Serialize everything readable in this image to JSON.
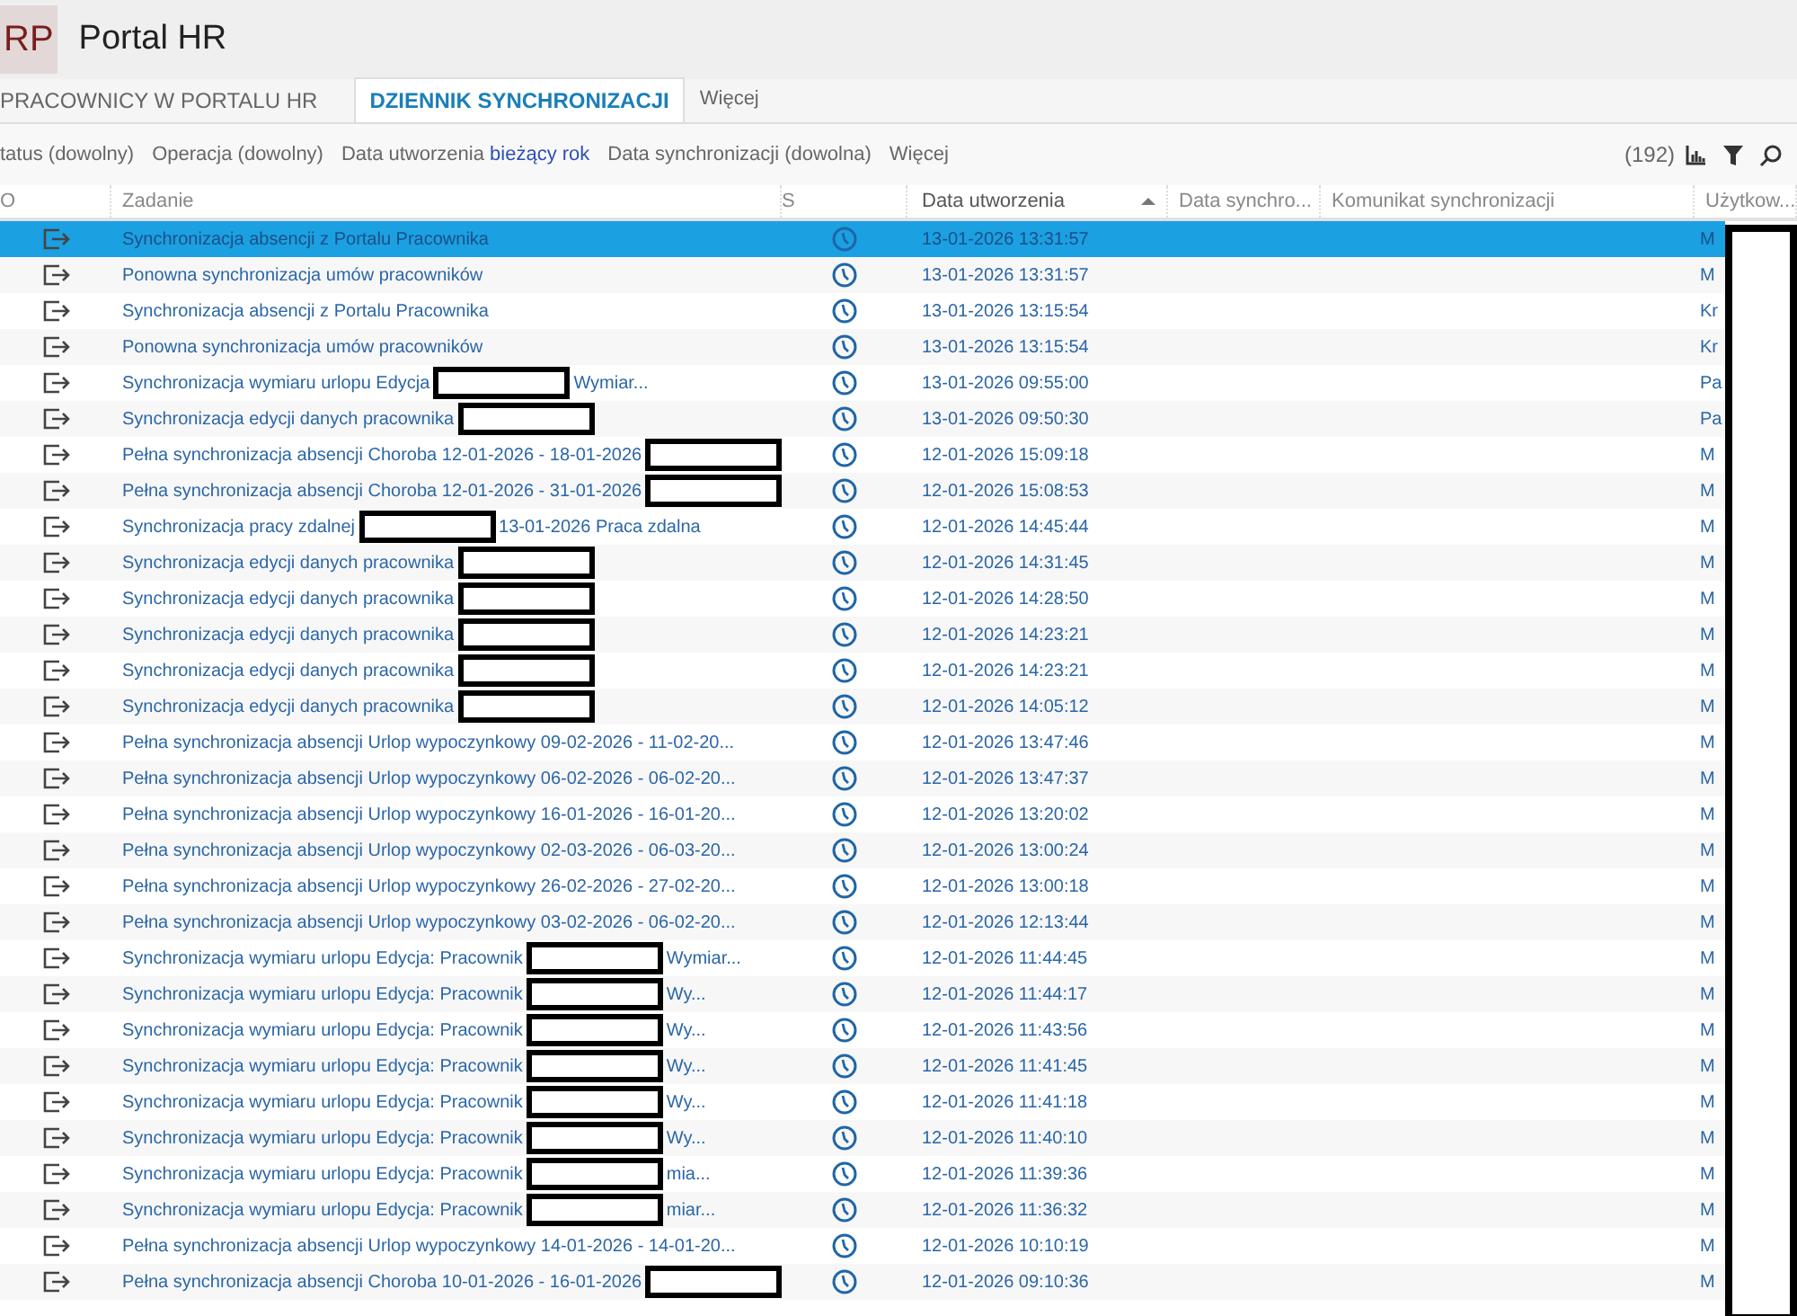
{
  "app": {
    "logo": "RP",
    "title": "Portal HR"
  },
  "tabs": [
    {
      "label": "PRACOWNICY W PORTALU HR",
      "selected": false
    },
    {
      "label": "DZIENNIK SYNCHRONIZACJI",
      "selected": true
    },
    {
      "label": "Więcej",
      "selected": false
    }
  ],
  "filters": [
    {
      "label": "tatus (dowolny)"
    },
    {
      "label": "Operacja (dowolny)"
    },
    {
      "label": "Data utworzenia",
      "value": "bieżący rok"
    },
    {
      "label": "Data synchronizacji (dowolna)"
    },
    {
      "label": "Więcej"
    }
  ],
  "count": "(192)",
  "table": {
    "columns": [
      {
        "label": "O",
        "sorted": false
      },
      {
        "label": "Zadanie",
        "sorted": false
      },
      {
        "label": "S",
        "sorted": false
      },
      {
        "label": "Data utworzenia",
        "sorted": true
      },
      {
        "label": "Data synchro...",
        "sorted": false
      },
      {
        "label": "Komunikat synchronizacji",
        "sorted": false
      },
      {
        "label": "Użytkow...",
        "sorted": false
      }
    ],
    "user_column_redacted": true,
    "rows": [
      {
        "selected": true,
        "task": [
          {
            "text": "Synchronizacja absencji z Portalu Pracownika"
          }
        ],
        "created": "13-01-2026 13:31:57",
        "user": "M"
      },
      {
        "selected": false,
        "task": [
          {
            "text": "Ponowna synchronizacja umów pracowników"
          }
        ],
        "created": "13-01-2026 13:31:57",
        "user": "M"
      },
      {
        "selected": false,
        "task": [
          {
            "text": "Synchronizacja absencji z Portalu Pracownika"
          }
        ],
        "created": "13-01-2026 13:15:54",
        "user": "Kr"
      },
      {
        "selected": false,
        "task": [
          {
            "text": "Ponowna synchronizacja umów pracowników"
          }
        ],
        "created": "13-01-2026 13:15:54",
        "user": "Kr"
      },
      {
        "selected": false,
        "task": [
          {
            "text": "Synchronizacja wymiaru urlopu Edycja"
          },
          {
            "kind": "redaction"
          },
          {
            "text": "Wymiar..."
          }
        ],
        "created": "13-01-2026 09:55:00",
        "user": "Pa"
      },
      {
        "selected": false,
        "task": [
          {
            "text": "Synchronizacja edycji danych pracownika"
          },
          {
            "kind": "redaction"
          }
        ],
        "created": "13-01-2026 09:50:30",
        "user": "Pa"
      },
      {
        "selected": false,
        "task": [
          {
            "text": "Pełna synchronizacja absencji Choroba 12-01-2026 - 18-01-2026"
          },
          {
            "kind": "redaction"
          }
        ],
        "created": "12-01-2026 15:09:18",
        "user": "M"
      },
      {
        "selected": false,
        "task": [
          {
            "text": "Pełna synchronizacja absencji Choroba 12-01-2026 - 31-01-2026"
          },
          {
            "kind": "redaction"
          }
        ],
        "created": "12-01-2026 15:08:53",
        "user": "M"
      },
      {
        "selected": false,
        "task": [
          {
            "text": "Synchronizacja pracy zdalnej"
          },
          {
            "kind": "redaction"
          },
          {
            "text": "13-01-2026 Praca zdalna"
          }
        ],
        "created": "12-01-2026 14:45:44",
        "user": "M"
      },
      {
        "selected": false,
        "task": [
          {
            "text": "Synchronizacja edycji danych pracownika"
          },
          {
            "kind": "redaction"
          }
        ],
        "created": "12-01-2026 14:31:45",
        "user": "M"
      },
      {
        "selected": false,
        "task": [
          {
            "text": "Synchronizacja edycji danych pracownika"
          },
          {
            "kind": "redaction"
          }
        ],
        "created": "12-01-2026 14:28:50",
        "user": "M"
      },
      {
        "selected": false,
        "task": [
          {
            "text": "Synchronizacja edycji danych pracownika"
          },
          {
            "kind": "redaction"
          }
        ],
        "created": "12-01-2026 14:23:21",
        "user": "M"
      },
      {
        "selected": false,
        "task": [
          {
            "text": "Synchronizacja edycji danych pracownika"
          },
          {
            "kind": "redaction"
          }
        ],
        "created": "12-01-2026 14:23:21",
        "user": "M"
      },
      {
        "selected": false,
        "task": [
          {
            "text": "Synchronizacja edycji danych pracownika"
          },
          {
            "kind": "redaction"
          }
        ],
        "created": "12-01-2026 14:05:12",
        "user": "M"
      },
      {
        "selected": false,
        "task": [
          {
            "text": "Pełna synchronizacja absencji Urlop wypoczynkowy 09-02-2026 - 11-02-20..."
          }
        ],
        "created": "12-01-2026 13:47:46",
        "user": "M"
      },
      {
        "selected": false,
        "task": [
          {
            "text": "Pełna synchronizacja absencji Urlop wypoczynkowy 06-02-2026 - 06-02-20..."
          }
        ],
        "created": "12-01-2026 13:47:37",
        "user": "M"
      },
      {
        "selected": false,
        "task": [
          {
            "text": "Pełna synchronizacja absencji Urlop wypoczynkowy 16-01-2026 - 16-01-20..."
          }
        ],
        "created": "12-01-2026 13:20:02",
        "user": "M"
      },
      {
        "selected": false,
        "task": [
          {
            "text": "Pełna synchronizacja absencji Urlop wypoczynkowy 02-03-2026 - 06-03-20..."
          }
        ],
        "created": "12-01-2026 13:00:24",
        "user": "M"
      },
      {
        "selected": false,
        "task": [
          {
            "text": "Pełna synchronizacja absencji Urlop wypoczynkowy 26-02-2026 - 27-02-20..."
          }
        ],
        "created": "12-01-2026 13:00:18",
        "user": "M"
      },
      {
        "selected": false,
        "task": [
          {
            "text": "Pełna synchronizacja absencji Urlop wypoczynkowy 03-02-2026 - 06-02-20..."
          }
        ],
        "created": "12-01-2026 12:13:44",
        "user": "M"
      },
      {
        "selected": false,
        "task": [
          {
            "text": "Synchronizacja wymiaru urlopu Edycja: Pracownik"
          },
          {
            "kind": "redaction"
          },
          {
            "text": "Wymiar..."
          }
        ],
        "created": "12-01-2026 11:44:45",
        "user": "M"
      },
      {
        "selected": false,
        "task": [
          {
            "text": "Synchronizacja wymiaru urlopu Edycja: Pracownik"
          },
          {
            "kind": "redaction"
          },
          {
            "text": "Wy..."
          }
        ],
        "created": "12-01-2026 11:44:17",
        "user": "M"
      },
      {
        "selected": false,
        "task": [
          {
            "text": "Synchronizacja wymiaru urlopu Edycja: Pracownik"
          },
          {
            "kind": "redaction"
          },
          {
            "text": "Wy..."
          }
        ],
        "created": "12-01-2026 11:43:56",
        "user": "M"
      },
      {
        "selected": false,
        "task": [
          {
            "text": "Synchronizacja wymiaru urlopu Edycja: Pracownik"
          },
          {
            "kind": "redaction"
          },
          {
            "text": "Wy..."
          }
        ],
        "created": "12-01-2026 11:41:45",
        "user": "M"
      },
      {
        "selected": false,
        "task": [
          {
            "text": "Synchronizacja wymiaru urlopu Edycja: Pracownik"
          },
          {
            "kind": "redaction"
          },
          {
            "text": "Wy..."
          }
        ],
        "created": "12-01-2026 11:41:18",
        "user": "M"
      },
      {
        "selected": false,
        "task": [
          {
            "text": "Synchronizacja wymiaru urlopu Edycja: Pracownik"
          },
          {
            "kind": "redaction"
          },
          {
            "text": "Wy..."
          }
        ],
        "created": "12-01-2026 11:40:10",
        "user": "M"
      },
      {
        "selected": false,
        "task": [
          {
            "text": "Synchronizacja wymiaru urlopu Edycja: Pracownik"
          },
          {
            "kind": "redaction"
          },
          {
            "text": "mia..."
          }
        ],
        "created": "12-01-2026 11:39:36",
        "user": "M"
      },
      {
        "selected": false,
        "task": [
          {
            "text": "Synchronizacja wymiaru urlopu Edycja: Pracownik"
          },
          {
            "kind": "redaction"
          },
          {
            "text": "miar..."
          }
        ],
        "created": "12-01-2026 11:36:32",
        "user": "M"
      },
      {
        "selected": false,
        "task": [
          {
            "text": "Pełna synchronizacja absencji Urlop wypoczynkowy 14-01-2026 - 14-01-20..."
          }
        ],
        "created": "12-01-2026 10:10:19",
        "user": "M"
      },
      {
        "selected": false,
        "task": [
          {
            "text": "Pełna synchronizacja absencji Choroba 10-01-2026 - 16-01-2026"
          },
          {
            "kind": "redaction"
          }
        ],
        "created": "12-01-2026 09:10:36",
        "user": "M"
      }
    ]
  }
}
